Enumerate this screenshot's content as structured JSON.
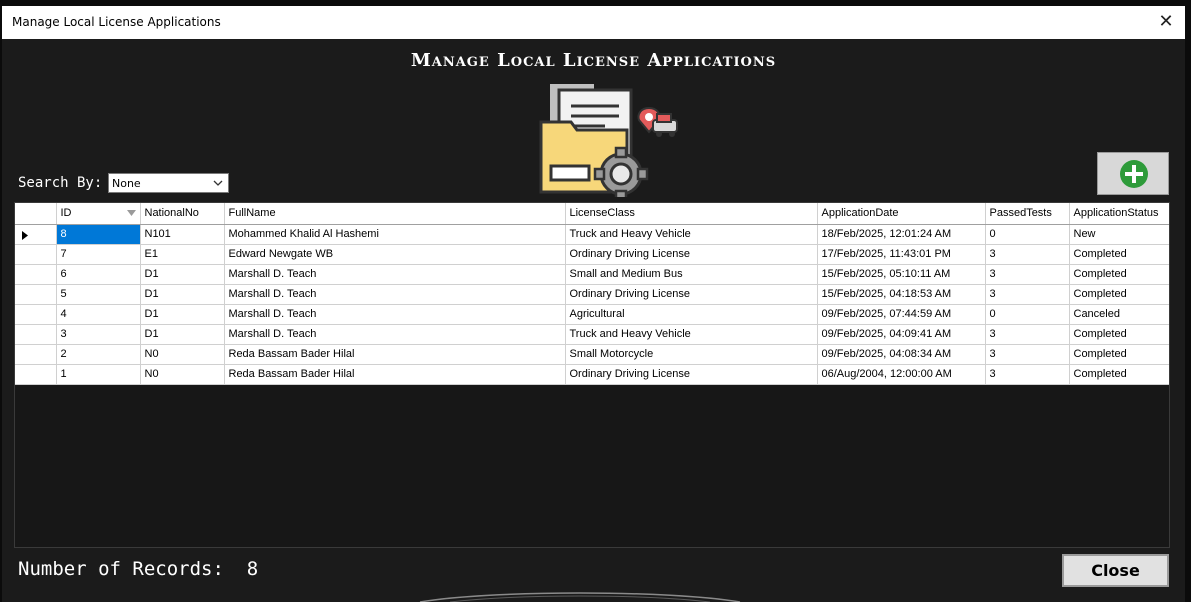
{
  "window": {
    "title": "Manage Local License Applications",
    "close_glyph": "✕"
  },
  "header": {
    "heading": "Manage Local License Applications",
    "icon": "license-folder-gear-car-icon"
  },
  "search": {
    "label": "Search By:",
    "selected": "None"
  },
  "toolbar": {
    "add_icon": "plus-circle-icon",
    "add_color": "#2e9b3a"
  },
  "grid": {
    "columns": [
      "ID",
      "NationalNo",
      "FullName",
      "LicenseClass",
      "ApplicationDate",
      "PassedTests",
      "ApplicationStatus"
    ],
    "rows": [
      [
        "8",
        "N101",
        "Mohammed Khalid Al Hashemi",
        "Truck and Heavy Vehicle",
        "18/Feb/2025, 12:01:24 AM",
        "0",
        "New"
      ],
      [
        "7",
        "E1",
        "Edward  Newgate WB",
        "Ordinary Driving License",
        "17/Feb/2025, 11:43:01 PM",
        "3",
        "Completed"
      ],
      [
        "6",
        "D1",
        "Marshall D. Teach",
        "Small and Medium Bus",
        "15/Feb/2025, 05:10:11 AM",
        "3",
        "Completed"
      ],
      [
        "5",
        "D1",
        "Marshall D. Teach",
        "Ordinary Driving License",
        "15/Feb/2025, 04:18:53 AM",
        "3",
        "Completed"
      ],
      [
        "4",
        "D1",
        "Marshall D. Teach",
        "Agricultural",
        "09/Feb/2025, 07:44:59 AM",
        "0",
        "Canceled"
      ],
      [
        "3",
        "D1",
        "Marshall D. Teach",
        "Truck and Heavy Vehicle",
        "09/Feb/2025, 04:09:41 AM",
        "3",
        "Completed"
      ],
      [
        "2",
        "N0",
        "Reda Bassam Bader Hilal",
        "Small Motorcycle",
        "09/Feb/2025, 04:08:34 AM",
        "3",
        "Completed"
      ],
      [
        "1",
        "N0",
        "Reda Bassam Bader Hilal",
        "Ordinary Driving License",
        "06/Aug/2004, 12:00:00 AM",
        "3",
        "Completed"
      ]
    ],
    "selection_color": "#0078d7"
  },
  "footer": {
    "records_label": "Number of Records:",
    "records_count": "8",
    "close_label": "Close"
  }
}
